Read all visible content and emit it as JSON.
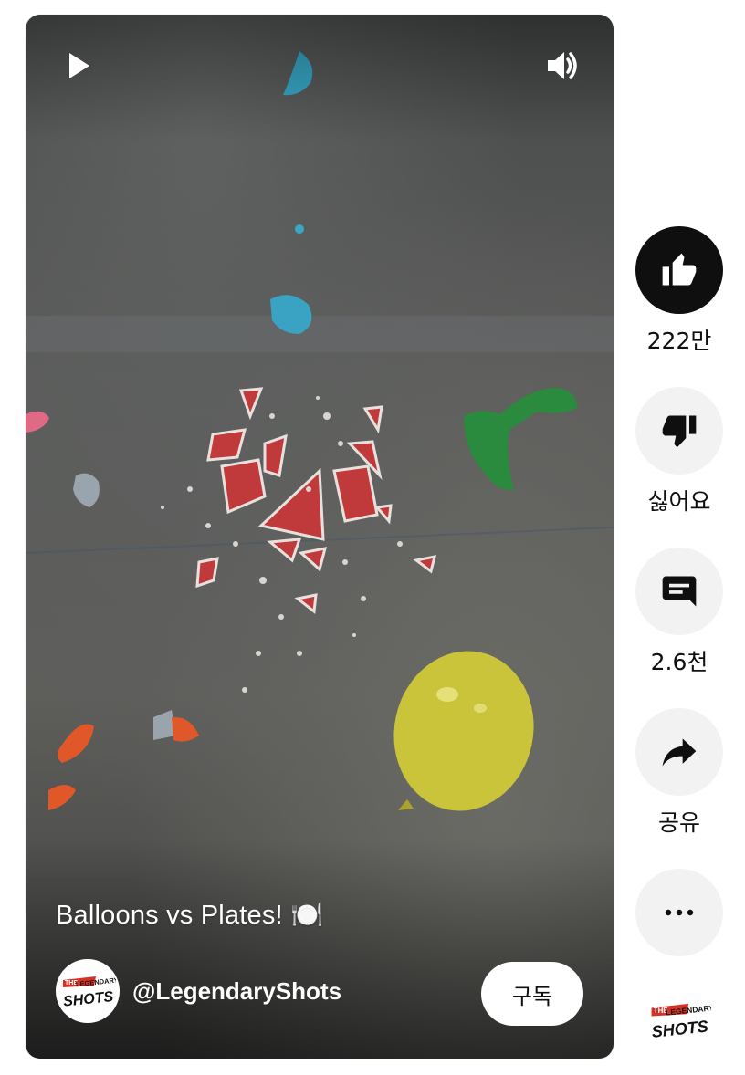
{
  "video": {
    "title": "Balloons vs Plates! 🍽️",
    "channel_name": "@LegendaryShots",
    "subscribe_label": "구독",
    "controls": {
      "play_icon": "play-icon",
      "volume_icon": "volume-icon"
    }
  },
  "actions": {
    "like": {
      "icon": "thumbs-up-icon",
      "label": "222만"
    },
    "dislike": {
      "icon": "thumbs-down-icon",
      "label": "싫어요"
    },
    "comments": {
      "icon": "comment-icon",
      "label": "2.6천"
    },
    "share": {
      "icon": "share-icon",
      "label": "공유"
    },
    "more": {
      "icon": "more-horizontal-icon"
    }
  },
  "brand": {
    "logo_text_top": "THE",
    "logo_text_mid": "LEGENDARY",
    "logo_text_bottom": "SHOTS",
    "accent": "#d93025"
  },
  "colors": {
    "like_active_bg": "#0f0f0f",
    "action_bg": "#f2f2f2",
    "balloon_yellow": "#c9c43a",
    "balloon_green": "#2a8a3e",
    "balloon_blue": "#38a8c8",
    "plate_red": "#c0393b"
  }
}
